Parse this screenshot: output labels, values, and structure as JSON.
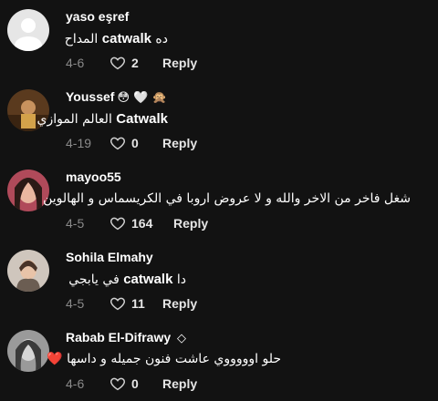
{
  "comments": [
    {
      "username": "yaso eşref",
      "emojis": "",
      "text_rtl_before": "ده",
      "text_latin": "catwalk",
      "text_rtl_after": "المداح",
      "date": "4-6",
      "likes": "2",
      "reply": "Reply"
    },
    {
      "username": "Youssef",
      "emojis": "😳 🤍 🙊",
      "text_rtl_before": "",
      "text_latin": "Catwalk",
      "text_rtl_after": "العالم الموازي",
      "date": "4-19",
      "likes": "0",
      "reply": "Reply"
    },
    {
      "username": "mayoo55",
      "emojis": "",
      "text_rtl_before": "شغل فاخر من الاخر والله و لا عروض اروبا في الكريسماس و الهالوين",
      "text_latin": "",
      "text_rtl_after": "",
      "date": "4-5",
      "likes": "164",
      "reply": "Reply"
    },
    {
      "username": "Sohila Elmahy",
      "emojis": "",
      "text_rtl_before": "دا",
      "text_latin": "catwalk",
      "text_rtl_after": "في يابجي",
      "date": "4-5",
      "likes": "11",
      "reply": "Reply"
    },
    {
      "username": "Rabab El-Difrawy",
      "emojis": "◇",
      "text_rtl_before": "حلو اوووووي عاشت فنون جميله و داسها",
      "text_latin": "",
      "text_rtl_after": "❤️",
      "date": "4-6",
      "likes": "0",
      "reply": "Reply"
    }
  ],
  "colors": {
    "background": "#121212",
    "date": "#8a8a8a",
    "text": "#ffffff"
  }
}
